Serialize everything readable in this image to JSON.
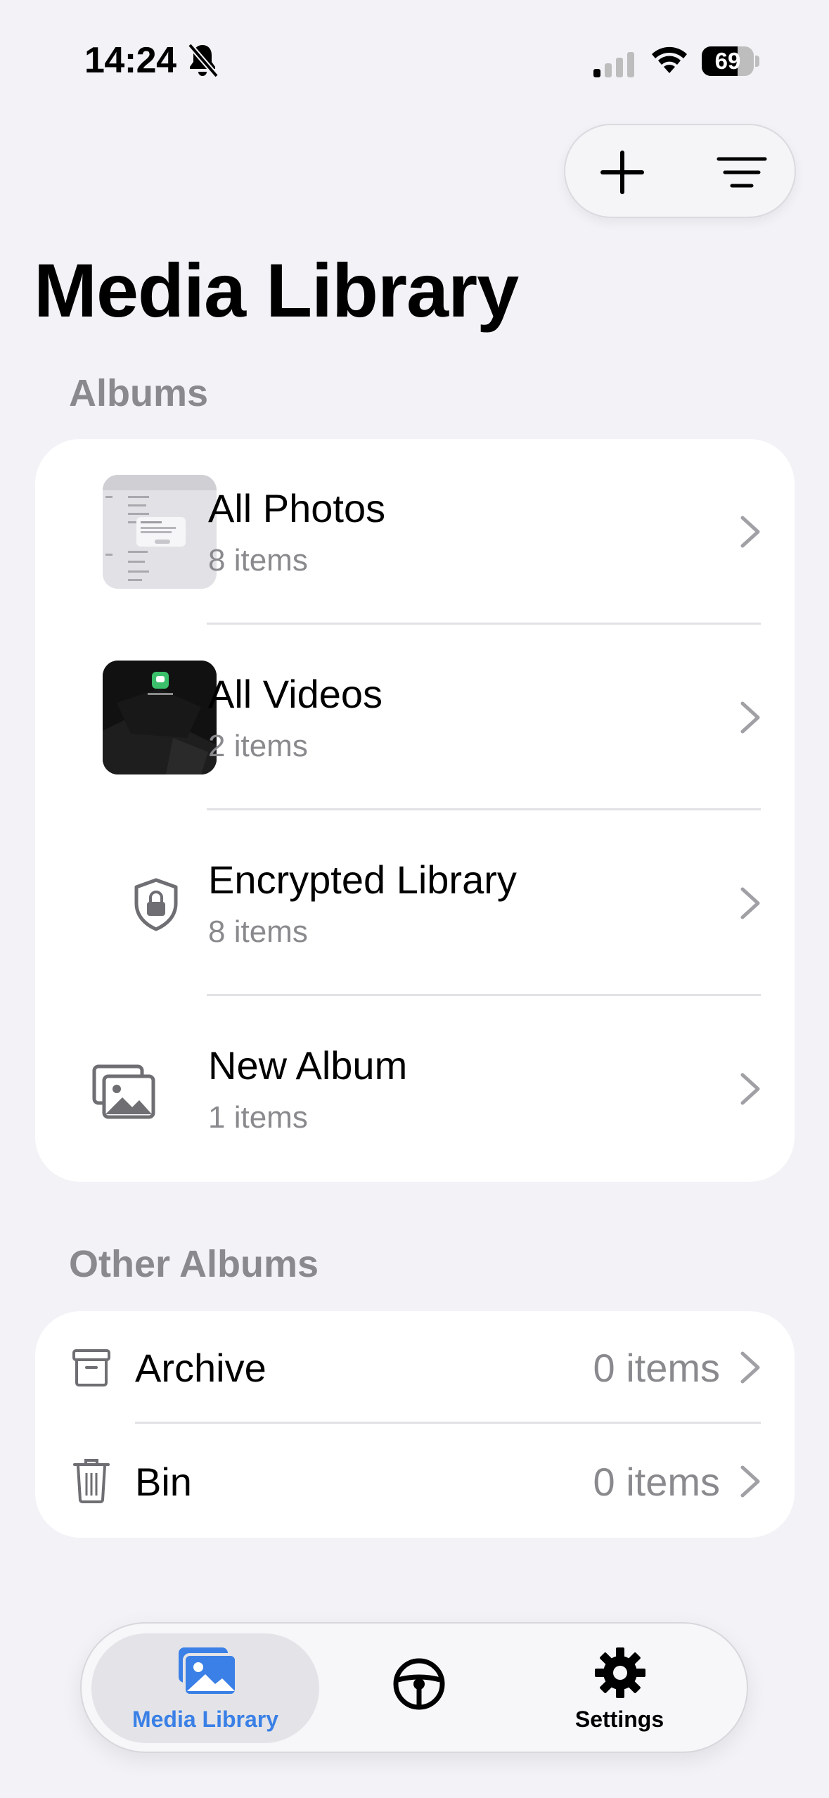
{
  "status_bar": {
    "time": "14:24",
    "battery": "69",
    "battery_level": 0.69
  },
  "header": {
    "title": "Media Library",
    "add_icon": "plus-icon",
    "sort_icon": "filter-lines-icon"
  },
  "albums": {
    "header": "Albums",
    "items": [
      {
        "title": "All Photos",
        "count": "8 items",
        "icon": "photo-thumbnail"
      },
      {
        "title": "All Videos",
        "count": "2 items",
        "icon": "video-thumbnail"
      },
      {
        "title": "Encrypted Library",
        "count": "8 items",
        "icon": "shield-lock-icon"
      },
      {
        "title": "New Album",
        "count": "1 items",
        "icon": "photos-stack-icon"
      }
    ]
  },
  "other_albums": {
    "header": "Other Albums",
    "items": [
      {
        "title": "Archive",
        "count": "0 items",
        "icon": "archive-box-icon"
      },
      {
        "title": "Bin",
        "count": "0 items",
        "icon": "trash-icon"
      }
    ]
  },
  "tab_bar": {
    "tabs": [
      {
        "label": "Media Library",
        "icon": "photos-stack-icon",
        "active": true
      },
      {
        "label": "",
        "icon": "steering-wheel-icon",
        "active": false
      },
      {
        "label": "Settings",
        "icon": "gear-icon",
        "active": false
      }
    ],
    "accent": "#3A80E6"
  },
  "colors": {
    "background": "#F2F2F7",
    "card": "#FFFFFF",
    "secondary_text": "#8A8A8E",
    "accent": "#3A80E6"
  }
}
